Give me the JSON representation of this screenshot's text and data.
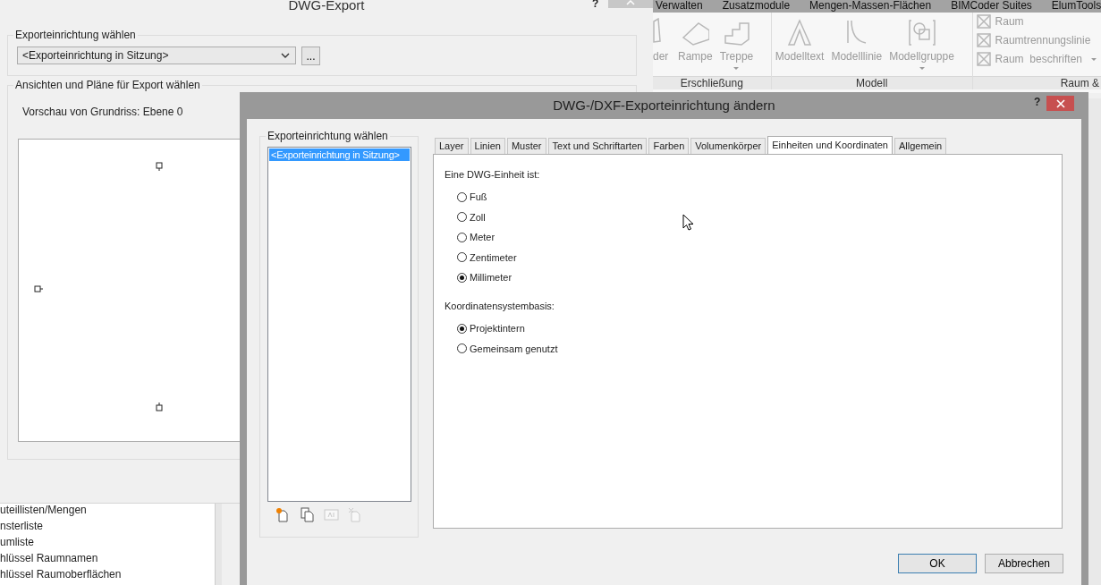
{
  "ribbon": {
    "tabs": [
      "Verwalten",
      "Zusatzmodule",
      "Mengen-Massen-Flächen",
      "BIMCoder Suites",
      "ElumTools"
    ],
    "panels": [
      {
        "label": "Erschließung",
        "buttons": [
          {
            "kind": "partial",
            "label": "der"
          },
          {
            "kind": "ramp",
            "label": "Rampe"
          },
          {
            "kind": "stair",
            "label": "Treppe",
            "dropdown": true
          }
        ]
      },
      {
        "label": "Modell",
        "buttons": [
          {
            "kind": "text",
            "label": "Modelltext"
          },
          {
            "kind": "line",
            "label": "Modelllinie"
          },
          {
            "kind": "group",
            "label": "Modellgruppe",
            "dropdown": true
          }
        ]
      },
      {
        "label": "Raum &",
        "items": [
          {
            "label": "Raum"
          },
          {
            "label": "Raumtrennungslinie"
          },
          {
            "label": "Raum  beschriften",
            "dropdown": true
          }
        ]
      }
    ]
  },
  "export_dialog": {
    "title": "DWG-Export",
    "help": "?",
    "setup_group": {
      "label": "Exporteinrichtung wählen",
      "combo_value": "<Exporteinrichtung in Sitzung>",
      "browse": "..."
    },
    "views_group": {
      "label": "Ansichten und Pläne für Export wählen",
      "preview_label": "Vorschau von Grundriss: Ebene 0"
    }
  },
  "project_browser": {
    "items": [
      "uteillisten/Mengen",
      "nsterliste",
      "umliste",
      "hlüssel Raumnamen",
      "hlüssel Raumoberflächen"
    ]
  },
  "setup_dialog": {
    "title": "DWG-/DXF-Exporteinrichtung ändern",
    "help": "?",
    "setup_group": {
      "label": "Exporteinrichtung wählen",
      "items": [
        {
          "label": "<Exporteinrichtung in Sitzung>",
          "selected": true
        }
      ],
      "tools": [
        {
          "kind": "new",
          "disabled": false
        },
        {
          "kind": "copy",
          "disabled": false
        },
        {
          "kind": "rename",
          "disabled": true
        },
        {
          "kind": "delete",
          "disabled": true
        }
      ]
    },
    "tabs": [
      {
        "label": "Layer",
        "selected": false
      },
      {
        "label": "Linien",
        "selected": false
      },
      {
        "label": "Muster",
        "selected": false
      },
      {
        "label": "Text und Schriftarten",
        "selected": false
      },
      {
        "label": "Farben",
        "selected": false
      },
      {
        "label": "Volumenkörper",
        "selected": false
      },
      {
        "label": "Einheiten und Koordinaten",
        "selected": true
      },
      {
        "label": "Allgemein",
        "selected": false
      }
    ],
    "units_label": "Eine DWG-Einheit ist:",
    "units": [
      {
        "label": "Fuß",
        "selected": false
      },
      {
        "label": "Zoll",
        "selected": false
      },
      {
        "label": "Meter",
        "selected": false
      },
      {
        "label": "Zentimeter",
        "selected": false
      },
      {
        "label": "Millimeter",
        "selected": true
      }
    ],
    "coords_label": "Koordinatensystembasis:",
    "coords": [
      {
        "label": "Projektintern",
        "selected": true
      },
      {
        "label": "Gemeinsam genutzt",
        "selected": false
      }
    ],
    "buttons": [
      {
        "label": "OK",
        "focused": true
      },
      {
        "label": "Abbrechen",
        "focused": false
      }
    ]
  }
}
